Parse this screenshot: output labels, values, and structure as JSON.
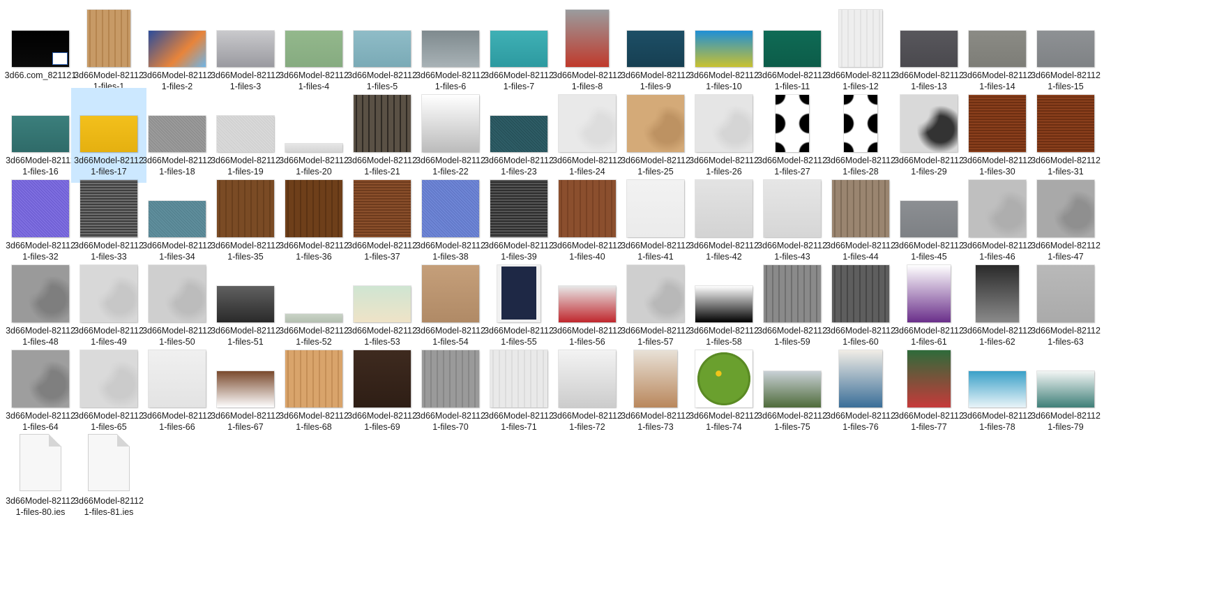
{
  "window": {
    "view": "Large icons"
  },
  "files": [
    {
      "name": "3d66.com_821121",
      "type": "image",
      "thumb": "black-screenshot",
      "aspect": "wide",
      "colors": [
        "#000000",
        "#0a0a0a"
      ]
    },
    {
      "name": "3d66Model-821121-files-1",
      "type": "image",
      "thumb": "light-wood",
      "aspect": "tall",
      "colors": [
        "#c79a66",
        "#b5854f"
      ]
    },
    {
      "name": "3d66Model-821121-files-2",
      "type": "image",
      "thumb": "colorful-light-art",
      "aspect": "wide",
      "colors": [
        "#2b4c9b",
        "#e8843a",
        "#6fb4e6"
      ]
    },
    {
      "name": "3d66Model-821121-files-3",
      "type": "image",
      "thumb": "backstage-architecture-book",
      "aspect": "wide",
      "colors": [
        "#c9c9cc",
        "#9a9aa0"
      ]
    },
    {
      "name": "3d66Model-821121-files-4",
      "type": "image",
      "thumb": "green-book",
      "aspect": "wide",
      "colors": [
        "#93b88c",
        "#86ab80"
      ]
    },
    {
      "name": "3d66Model-821121-files-5",
      "type": "image",
      "thumb": "blue-book",
      "aspect": "wide",
      "colors": [
        "#8fbcc7",
        "#7aaab6"
      ]
    },
    {
      "name": "3d66Model-821121-files-6",
      "type": "image",
      "thumb": "tokyo-city",
      "aspect": "wide",
      "colors": [
        "#7f8a8e",
        "#a8b2b6"
      ]
    },
    {
      "name": "3d66Model-821121-files-7",
      "type": "image",
      "thumb": "teal-book",
      "aspect": "wide",
      "colors": [
        "#3fb0b5",
        "#2d9aa0"
      ]
    },
    {
      "name": "3d66Model-821121-files-8",
      "type": "image",
      "thumb": "grey-book-red-text",
      "aspect": "tall",
      "colors": [
        "#9a9c9e",
        "#c0392b"
      ]
    },
    {
      "name": "3d66Model-821121-files-9",
      "type": "image",
      "thumb": "dark-teal-book",
      "aspect": "wide",
      "colors": [
        "#1d4f66",
        "#163f52"
      ]
    },
    {
      "name": "3d66Model-821121-files-10",
      "type": "image",
      "thumb": "young-architects-award",
      "aspect": "wide",
      "colors": [
        "#1f8fd6",
        "#c9c130"
      ]
    },
    {
      "name": "3d66Model-821121-files-11",
      "type": "image",
      "thumb": "dark-green-book",
      "aspect": "wide",
      "colors": [
        "#0f6b55",
        "#0c5c49"
      ]
    },
    {
      "name": "3d66Model-821121-files-12",
      "type": "image",
      "thumb": "white-wood",
      "aspect": "tall",
      "colors": [
        "#eeeeee",
        "#e2e2e2"
      ]
    },
    {
      "name": "3d66Model-821121-files-13",
      "type": "image",
      "thumb": "dark-grey-book",
      "aspect": "wide",
      "colors": [
        "#58575c",
        "#4a494e"
      ]
    },
    {
      "name": "3d66Model-821121-files-14",
      "type": "image",
      "thumb": "grey-book-cats",
      "aspect": "wide",
      "colors": [
        "#8b8b85",
        "#7d7d77"
      ]
    },
    {
      "name": "3d66Model-821121-files-15",
      "type": "image",
      "thumb": "grey-book",
      "aspect": "wide",
      "colors": [
        "#8e9194",
        "#7f8285"
      ]
    },
    {
      "name": "3d66Model-821121-files-16",
      "type": "image",
      "thumb": "teal-book-clouds",
      "aspect": "wide",
      "colors": [
        "#3b7f7c",
        "#2f6b69"
      ]
    },
    {
      "name": "3d66Model-821121-files-17",
      "type": "image",
      "thumb": "yellow-book",
      "aspect": "wide",
      "colors": [
        "#f3c01c",
        "#e5b010"
      ],
      "selected": true
    },
    {
      "name": "3d66Model-821121-files-18",
      "type": "image",
      "thumb": "grey-fabric",
      "aspect": "wide",
      "colors": [
        "#9b9b9b",
        "#8a8a8a"
      ]
    },
    {
      "name": "3d66Model-821121-files-19",
      "type": "image",
      "thumb": "light-fabric",
      "aspect": "wide",
      "colors": [
        "#d9d9d9",
        "#cecece"
      ]
    },
    {
      "name": "3d66Model-821121-files-20",
      "type": "image",
      "thumb": "thin-strip",
      "aspect": "strip",
      "colors": [
        "#e6e6e6",
        "#d4d4d4"
      ]
    },
    {
      "name": "3d66Model-821121-files-21",
      "type": "image",
      "thumb": "dirty-wood",
      "aspect": "square",
      "colors": [
        "#5a5145",
        "#2f2a24"
      ]
    },
    {
      "name": "3d66Model-821121-files-22",
      "type": "image",
      "thumb": "circle-sketch",
      "aspect": "square",
      "colors": [
        "#ffffff",
        "#bbbbbb"
      ]
    },
    {
      "name": "3d66Model-821121-files-23",
      "type": "image",
      "thumb": "teal-fabric",
      "aspect": "wide",
      "colors": [
        "#2e5d66",
        "#244d55"
      ]
    },
    {
      "name": "3d66Model-821121-files-24",
      "type": "image",
      "thumb": "white-plaster",
      "aspect": "square",
      "colors": [
        "#e9e9e9",
        "#dddddd"
      ]
    },
    {
      "name": "3d66Model-821121-files-25",
      "type": "image",
      "thumb": "tan-plaster",
      "aspect": "square",
      "colors": [
        "#d4aa78",
        "#bd9262"
      ]
    },
    {
      "name": "3d66Model-821121-files-26",
      "type": "image",
      "thumb": "white-marble",
      "aspect": "square",
      "colors": [
        "#e5e5e5",
        "#d5d5d5"
      ]
    },
    {
      "name": "3d66Model-821121-files-27",
      "type": "image",
      "thumb": "black-dots-blur",
      "aspect": "tall-narrow",
      "colors": [
        "#000000",
        "#ffffff"
      ]
    },
    {
      "name": "3d66Model-821121-files-28",
      "type": "image",
      "thumb": "black-dots",
      "aspect": "tall-narrow",
      "colors": [
        "#000000",
        "#ffffff"
      ]
    },
    {
      "name": "3d66Model-821121-files-29",
      "type": "image",
      "thumb": "terrazzo",
      "aspect": "square",
      "colors": [
        "#d9d9d9",
        "#333333"
      ]
    },
    {
      "name": "3d66Model-821121-files-30",
      "type": "image",
      "thumb": "rust-weave",
      "aspect": "square",
      "colors": [
        "#8a3f1c",
        "#6e2f12"
      ]
    },
    {
      "name": "3d66Model-821121-files-31",
      "type": "image",
      "thumb": "rust-weave",
      "aspect": "square",
      "colors": [
        "#8a3f1c",
        "#6e2f12"
      ]
    },
    {
      "name": "3d66Model-821121-files-32",
      "type": "image",
      "thumb": "purple-fabric",
      "aspect": "square",
      "colors": [
        "#7f6fe0",
        "#6a5ad0"
      ]
    },
    {
      "name": "3d66Model-821121-files-33",
      "type": "image",
      "thumb": "grey-weave",
      "aspect": "square",
      "colors": [
        "#6e6e6e",
        "#3e3e3e"
      ]
    },
    {
      "name": "3d66Model-821121-files-34",
      "type": "image",
      "thumb": "blue-teal-fabric",
      "aspect": "wide",
      "colors": [
        "#5f8e9c",
        "#527f8d"
      ]
    },
    {
      "name": "3d66Model-821121-files-35",
      "type": "image",
      "thumb": "brown-wood",
      "aspect": "square",
      "colors": [
        "#7a4b25",
        "#6a3f1c"
      ]
    },
    {
      "name": "3d66Model-821121-files-36",
      "type": "image",
      "thumb": "brown-wood-dark",
      "aspect": "square",
      "colors": [
        "#6e3f1a",
        "#5c3313"
      ]
    },
    {
      "name": "3d66Model-821121-files-37",
      "type": "image",
      "thumb": "brown-weave",
      "aspect": "square",
      "colors": [
        "#8a4f2b",
        "#6e3b1d"
      ]
    },
    {
      "name": "3d66Model-821121-files-38",
      "type": "image",
      "thumb": "blue-fabric",
      "aspect": "square",
      "colors": [
        "#6f86d6",
        "#5d74c4"
      ]
    },
    {
      "name": "3d66Model-821121-files-39",
      "type": "image",
      "thumb": "dark-weave",
      "aspect": "square",
      "colors": [
        "#555555",
        "#2e2e2e"
      ]
    },
    {
      "name": "3d66Model-821121-files-40",
      "type": "image",
      "thumb": "walnut-wood",
      "aspect": "square",
      "colors": [
        "#8b4f2e",
        "#7a4224"
      ]
    },
    {
      "name": "3d66Model-821121-files-41",
      "type": "image",
      "thumb": "white-plain",
      "aspect": "square",
      "colors": [
        "#f2f2f2",
        "#ebebeb"
      ]
    },
    {
      "name": "3d66Model-821121-files-42",
      "type": "image",
      "thumb": "white-brushed",
      "aspect": "square",
      "colors": [
        "#e3e3e3",
        "#d3d3d3"
      ]
    },
    {
      "name": "3d66Model-821121-files-43",
      "type": "image",
      "thumb": "white-brushed",
      "aspect": "square",
      "colors": [
        "#e6e6e6",
        "#d6d6d6"
      ]
    },
    {
      "name": "3d66Model-821121-files-44",
      "type": "image",
      "thumb": "weathered-wood",
      "aspect": "square",
      "colors": [
        "#9a8570",
        "#7f6c58"
      ]
    },
    {
      "name": "3d66Model-821121-files-45",
      "type": "image",
      "thumb": "grey-book-dotline",
      "aspect": "wide",
      "colors": [
        "#8c8f93",
        "#7d8084"
      ]
    },
    {
      "name": "3d66Model-821121-files-46",
      "type": "image",
      "thumb": "light-grey-plaster",
      "aspect": "square",
      "colors": [
        "#bfbfbf",
        "#aeaeae"
      ]
    },
    {
      "name": "3d66Model-821121-files-47",
      "type": "image",
      "thumb": "grey-concrete",
      "aspect": "square",
      "colors": [
        "#a9a9a9",
        "#8f8f8f"
      ]
    },
    {
      "name": "3d66Model-821121-files-48",
      "type": "image",
      "thumb": "grey-concrete-dark",
      "aspect": "square",
      "colors": [
        "#9a9a9a",
        "#7e7e7e"
      ]
    },
    {
      "name": "3d66Model-821121-files-49",
      "type": "image",
      "thumb": "light-concrete",
      "aspect": "square",
      "colors": [
        "#d8d8d8",
        "#c7c7c7"
      ]
    },
    {
      "name": "3d66Model-821121-files-50",
      "type": "image",
      "thumb": "light-concrete",
      "aspect": "square",
      "colors": [
        "#cfcfcf",
        "#bcbcbc"
      ]
    },
    {
      "name": "3d66Model-821121-files-51",
      "type": "image",
      "thumb": "london-bw",
      "aspect": "wide",
      "colors": [
        "#606060",
        "#2a2a2a"
      ]
    },
    {
      "name": "3d66Model-821121-files-52",
      "type": "image",
      "thumb": "thin-strip-green",
      "aspect": "strip",
      "colors": [
        "#c9d3c6",
        "#b5c0b2"
      ]
    },
    {
      "name": "3d66Model-821121-files-53",
      "type": "image",
      "thumb": "mint-book",
      "aspect": "wide",
      "colors": [
        "#cfe5d2",
        "#efe3c7"
      ]
    },
    {
      "name": "3d66Model-821121-files-54",
      "type": "image",
      "thumb": "kraft-book",
      "aspect": "square",
      "colors": [
        "#c59f7a",
        "#b08a66"
      ]
    },
    {
      "name": "3d66Model-821121-files-55",
      "type": "image",
      "thumb": "cat-man-poster",
      "aspect": "tall",
      "colors": [
        "#1e2845",
        "#ffffff"
      ]
    },
    {
      "name": "3d66Model-821121-files-56",
      "type": "image",
      "thumb": "red-stripe-book",
      "aspect": "wide",
      "colors": [
        "#e7e7e7",
        "#c0272d"
      ]
    },
    {
      "name": "3d66Model-821121-files-57",
      "type": "image",
      "thumb": "stucco",
      "aspect": "square",
      "colors": [
        "#cfcfcf",
        "#b8b8b8"
      ]
    },
    {
      "name": "3d66Model-821121-files-58",
      "type": "image",
      "thumb": "typography-poster",
      "aspect": "wide",
      "colors": [
        "#ffffff",
        "#000000"
      ]
    },
    {
      "name": "3d66Model-821121-files-59",
      "type": "image",
      "thumb": "grey-wood",
      "aspect": "square",
      "colors": [
        "#8a8a8a",
        "#6f6f6f"
      ]
    },
    {
      "name": "3d66Model-821121-files-60",
      "type": "image",
      "thumb": "dark-grey-wood",
      "aspect": "square",
      "colors": [
        "#5e5e5e",
        "#474747"
      ]
    },
    {
      "name": "3d66Model-821121-files-61",
      "type": "image",
      "thumb": "mac-screen",
      "aspect": "tall",
      "colors": [
        "#ffffff",
        "#6a2f8a"
      ]
    },
    {
      "name": "3d66Model-821121-files-62",
      "type": "image",
      "thumb": "bottle-photo",
      "aspect": "tall",
      "colors": [
        "#2a2a2a",
        "#8a8a8a"
      ]
    },
    {
      "name": "3d66Model-821121-files-63",
      "type": "image",
      "thumb": "grey-plain",
      "aspect": "square",
      "colors": [
        "#b9b9b9",
        "#aaaaaa"
      ]
    },
    {
      "name": "3d66Model-821121-files-64",
      "type": "image",
      "thumb": "grey-marble",
      "aspect": "square",
      "colors": [
        "#9e9e9e",
        "#7f7f7f"
      ]
    },
    {
      "name": "3d66Model-821121-files-65",
      "type": "image",
      "thumb": "white-concrete",
      "aspect": "square",
      "colors": [
        "#dadada",
        "#cbcbcb"
      ]
    },
    {
      "name": "3d66Model-821121-files-66",
      "type": "image",
      "thumb": "white-paper",
      "aspect": "square",
      "colors": [
        "#f0f0f0",
        "#e3e3e3"
      ]
    },
    {
      "name": "3d66Model-821121-files-67",
      "type": "image",
      "thumb": "brown-book",
      "aspect": "wide",
      "colors": [
        "#7a4a2e",
        "#ffffff"
      ]
    },
    {
      "name": "3d66Model-821121-files-68",
      "type": "image",
      "thumb": "pine-wood",
      "aspect": "square",
      "colors": [
        "#d9a46b",
        "#c58f57"
      ]
    },
    {
      "name": "3d66Model-821121-files-69",
      "type": "image",
      "thumb": "dark-walnut",
      "aspect": "square",
      "colors": [
        "#3e2a1f",
        "#2e1e15"
      ]
    },
    {
      "name": "3d66Model-821121-files-70",
      "type": "image",
      "thumb": "grey-planks",
      "aspect": "square",
      "colors": [
        "#9a9a9a",
        "#878787"
      ]
    },
    {
      "name": "3d66Model-821121-files-71",
      "type": "image",
      "thumb": "white-planks",
      "aspect": "square",
      "colors": [
        "#e9e9e9",
        "#dcdcdc"
      ]
    },
    {
      "name": "3d66Model-821121-files-72",
      "type": "image",
      "thumb": "plaid-cards",
      "aspect": "square",
      "colors": [
        "#f3f3f3",
        "#cccccc"
      ]
    },
    {
      "name": "3d66Model-821121-files-73",
      "type": "image",
      "thumb": "ornament-pattern",
      "aspect": "tall",
      "colors": [
        "#e8e1d7",
        "#b9875c"
      ]
    },
    {
      "name": "3d66Model-821121-files-74",
      "type": "image",
      "thumb": "green-round-rug",
      "aspect": "square",
      "colors": [
        "#6aa02e",
        "#f0c419"
      ]
    },
    {
      "name": "3d66Model-821121-files-75",
      "type": "image",
      "thumb": "apartment-photo",
      "aspect": "wide",
      "colors": [
        "#c9d1d6",
        "#4f6b3a"
      ]
    },
    {
      "name": "3d66Model-821121-files-76",
      "type": "image",
      "thumb": "blue-stripes-art",
      "aspect": "tall",
      "colors": [
        "#f1ede6",
        "#3a6e98"
      ]
    },
    {
      "name": "3d66Model-821121-files-77",
      "type": "image",
      "thumb": "green-stripes-art",
      "aspect": "tall",
      "colors": [
        "#2e6b3a",
        "#c63a3a"
      ]
    },
    {
      "name": "3d66Model-821121-files-78",
      "type": "image",
      "thumb": "blue-swirl-book",
      "aspect": "wide",
      "colors": [
        "#3aa0c8",
        "#e9f4f8"
      ]
    },
    {
      "name": "3d66Model-821121-files-79",
      "type": "image",
      "thumb": "teal-lines-book",
      "aspect": "wide",
      "colors": [
        "#f2f5f4",
        "#3f7f78"
      ]
    },
    {
      "name": "3d66Model-821121-files-80.ies",
      "type": "document",
      "thumb": "blank-file-icon"
    },
    {
      "name": "3d66Model-821121-files-81.ies",
      "type": "document",
      "thumb": "blank-file-icon"
    }
  ]
}
